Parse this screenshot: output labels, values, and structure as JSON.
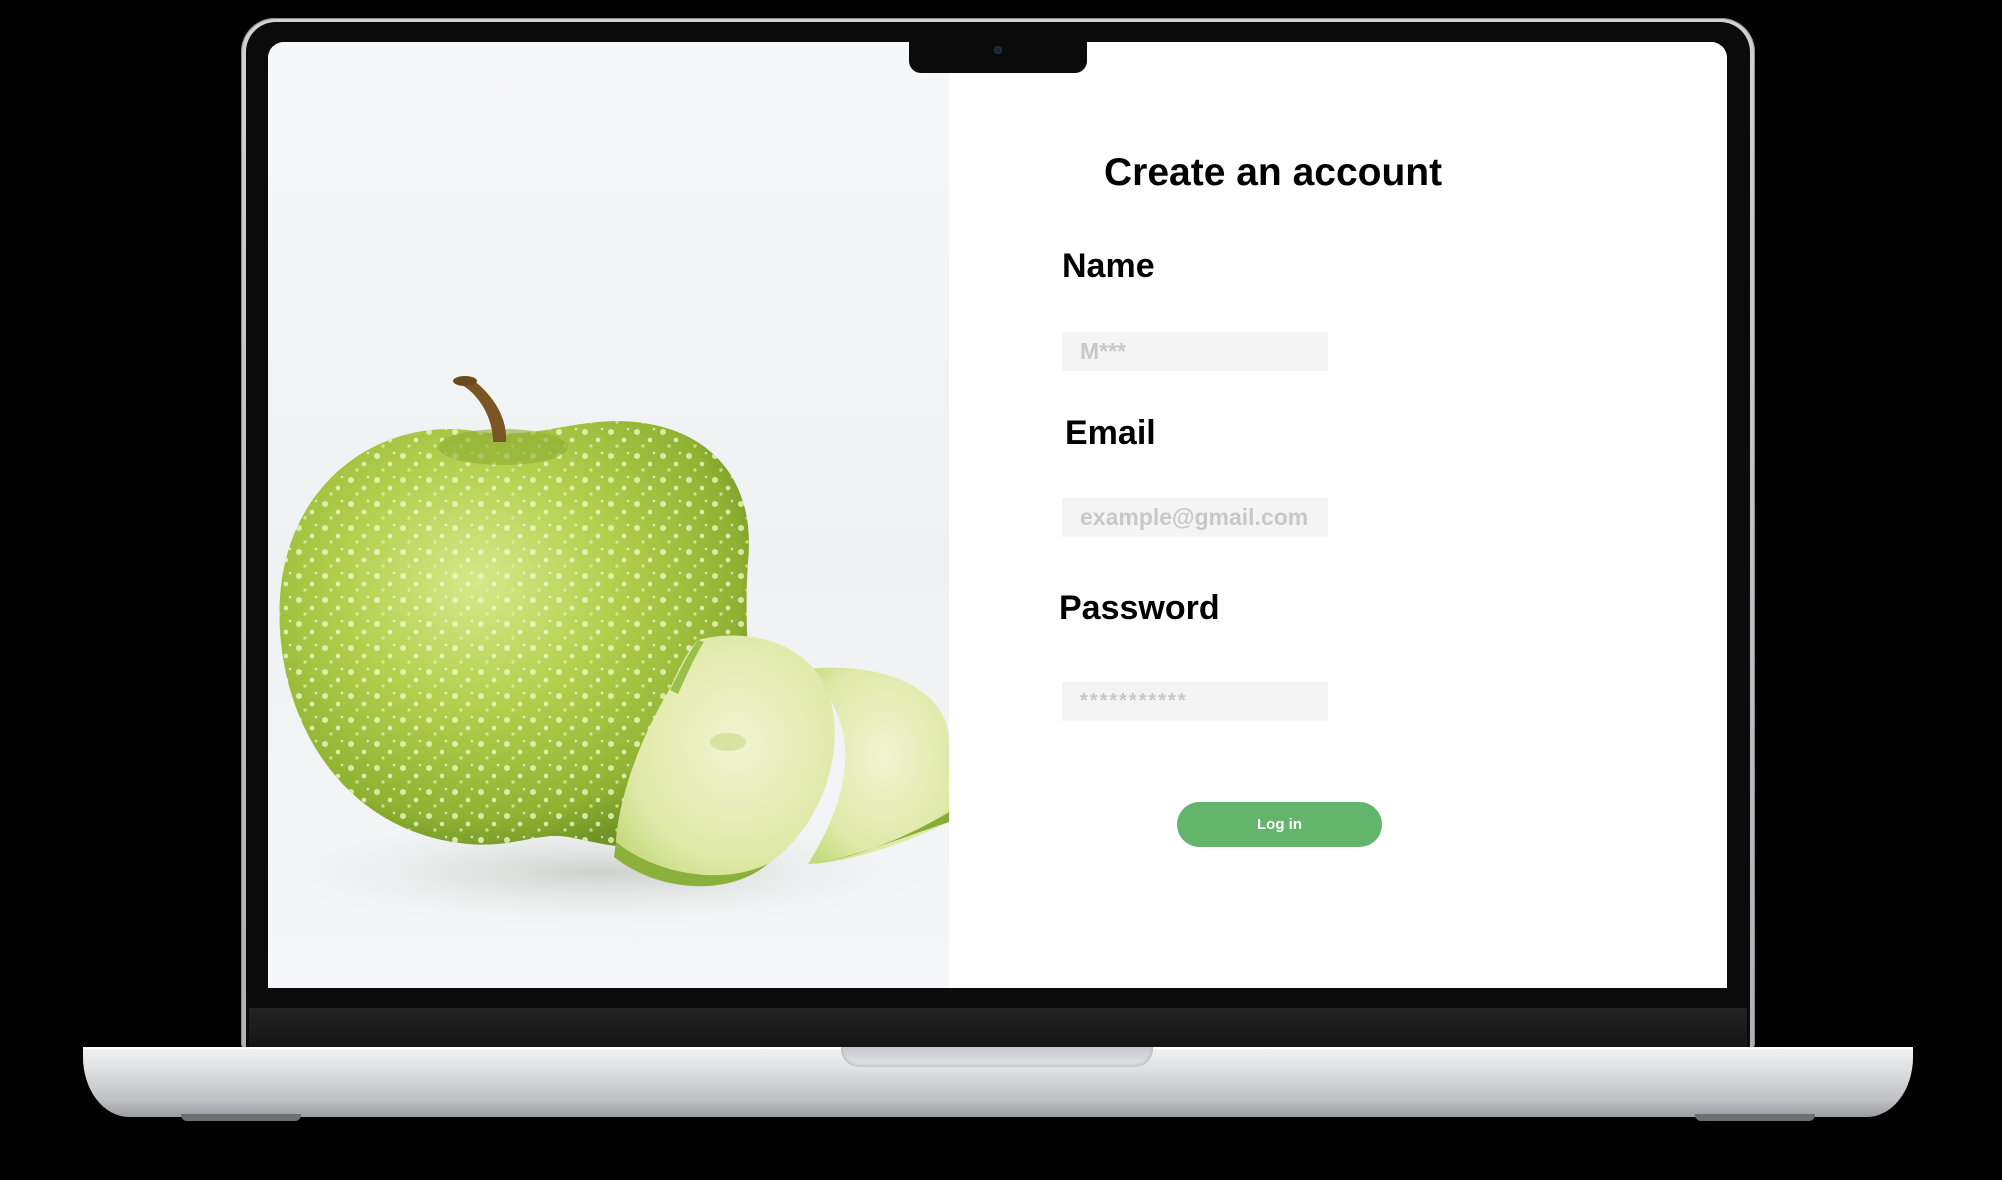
{
  "form": {
    "title": "Create an account",
    "name_label": "Name",
    "name_placeholder": "M***",
    "email_label": "Email",
    "email_placeholder": "example@gmail.com",
    "password_label": "Password",
    "password_placeholder": "***********",
    "submit_label": "Log in"
  },
  "hero_image": {
    "subject": "green-apple-with-slices"
  },
  "colors": {
    "accent": "#63b56c",
    "input_background": "#f4f4f4",
    "placeholder": "#c8c8c8",
    "apple_green": "#9bc03a",
    "background": "#000000"
  }
}
